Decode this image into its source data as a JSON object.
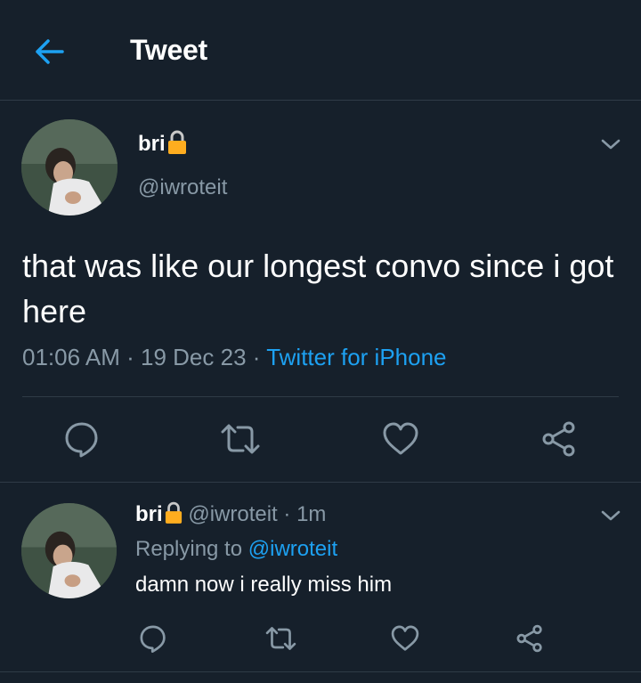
{
  "header": {
    "title": "Tweet"
  },
  "main_tweet": {
    "name": "bri",
    "handle": "@iwroteit",
    "text": "that was like our longest convo since i got here",
    "time": "01:06 AM",
    "sep1": "·",
    "date": "19 Dec 23",
    "sep2": "·",
    "source": "Twitter for iPhone"
  },
  "reply": {
    "name": "bri",
    "handle": "@iwroteit",
    "sep": "·",
    "time": "1m",
    "replying_prefix": "Replying to",
    "replying_handle": "@iwroteit",
    "text": "damn now i really miss him"
  },
  "icons": {
    "back": "arrow-left-icon",
    "lock": "lock-icon",
    "more": "chevron-down-icon",
    "reply": "comment-icon",
    "retweet": "retweet-icon",
    "like": "heart-icon",
    "share": "share-icon"
  },
  "colors": {
    "background": "#16202b",
    "divider": "#2f3b47",
    "muted": "#8899a6",
    "accent": "#1da1f2",
    "lock": "#ffad1f"
  }
}
